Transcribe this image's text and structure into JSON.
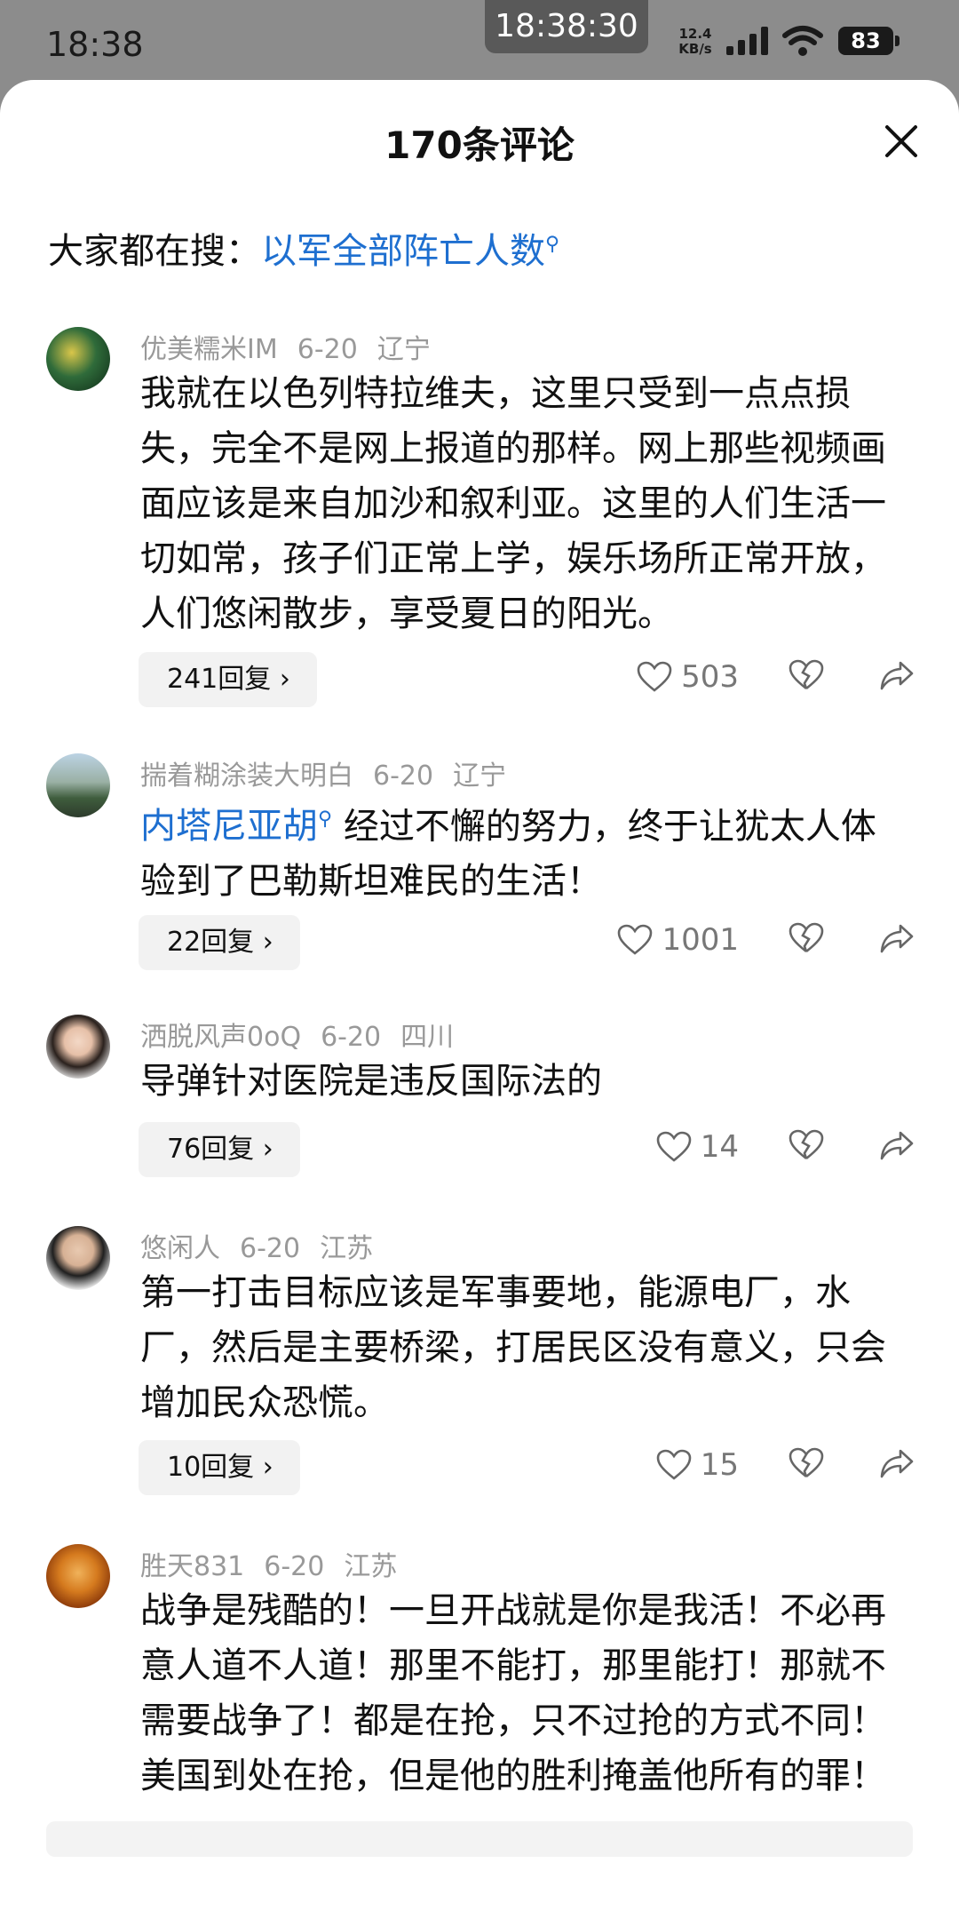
{
  "status_bar": {
    "time": "18:38",
    "center_clock": "18:38:30",
    "network_speed": "12.4",
    "network_unit": "KB/s",
    "battery": "83",
    "icons": [
      "signal-icon",
      "wifi-icon",
      "battery-icon"
    ]
  },
  "sheet": {
    "title": "170条评论",
    "search_prefix": "大家都在搜：",
    "search_term": "以军全部阵亡人数"
  },
  "comments": [
    {
      "username": "优美糯米IM",
      "date": "6-20",
      "location": "辽宁",
      "mention": "",
      "text": "我就在以色列特拉维夫，这里只受到一点点损失，完全不是网上报道的那样。网上那些视频画面应该是来自加沙和叙利亚。这里的人们生活一切如常，孩子们正常上学，娱乐场所正常开放，人们悠闲散步，享受夏日的阳光。",
      "replies": "241回复",
      "likes": "503"
    },
    {
      "username": "揣着糊涂装大明白",
      "date": "6-20",
      "location": "辽宁",
      "mention": "内塔尼亚胡",
      "text": "经过不懈的努力，终于让犹太人体验到了巴勒斯坦难民的生活！",
      "replies": "22回复",
      "likes": "1001"
    },
    {
      "username": "洒脱风声0oQ",
      "date": "6-20",
      "location": "四川",
      "mention": "",
      "text": "导弹针对医院是违反国际法的",
      "replies": "76回复",
      "likes": "14"
    },
    {
      "username": "悠闲人",
      "date": "6-20",
      "location": "江苏",
      "mention": "",
      "text": "第一打击目标应该是军事要地，能源电厂，水厂，然后是主要桥梁，打居民区没有意义，只会增加民众恐慌。",
      "replies": "10回复",
      "likes": "15"
    },
    {
      "username": "胜天831",
      "date": "6-20",
      "location": "江苏",
      "mention": "",
      "text": "战争是残酷的！一旦开战就是你是我活！不必再意人道不人道！那里不能打，那里能打！那就不需要战争了！都是在抢，只不过抢的方式不同！美国到处在抢，但是他的胜利掩盖他所有的罪！",
      "replies": "",
      "likes": ""
    }
  ],
  "colors": {
    "accent_link": "#1e6fd0",
    "meta_gray": "#999999",
    "status_bg": "#8c8c8c"
  }
}
